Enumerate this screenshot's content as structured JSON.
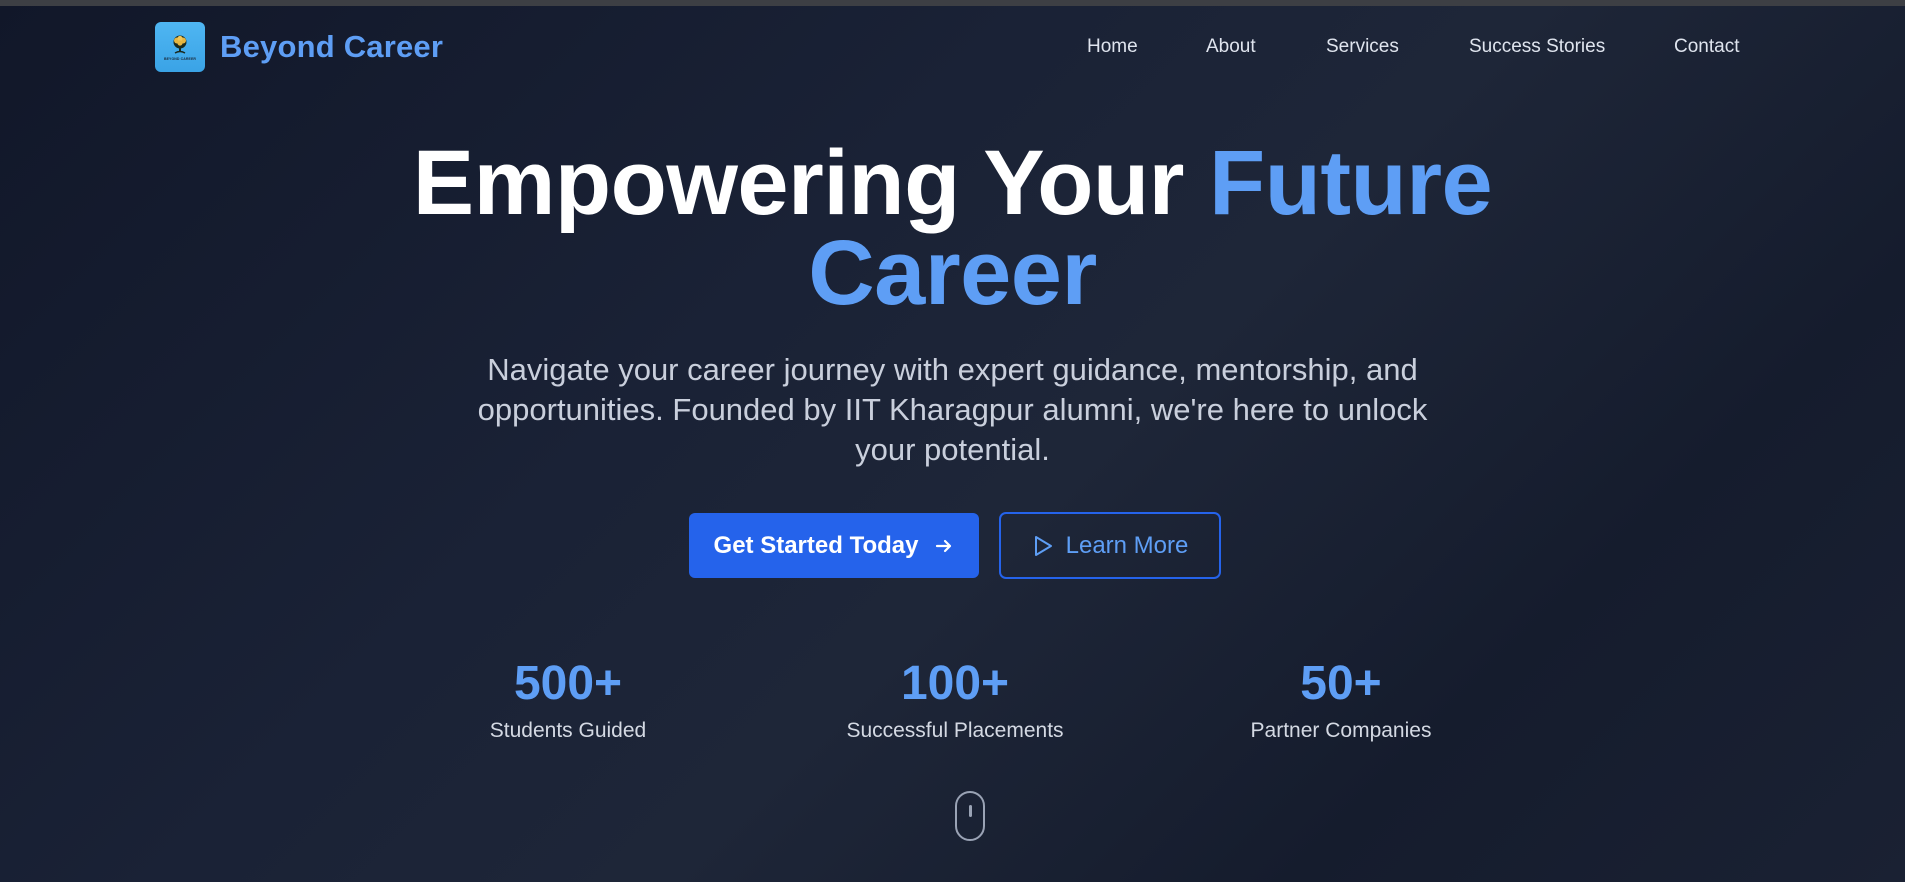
{
  "brand": {
    "name": "Beyond Career",
    "logo_text": "BEYOND CAREER"
  },
  "nav": {
    "items": [
      {
        "label": "Home"
      },
      {
        "label": "About"
      },
      {
        "label": "Services"
      },
      {
        "label": "Success Stories"
      },
      {
        "label": "Contact"
      }
    ]
  },
  "hero": {
    "title_part1": "Empowering Your ",
    "title_accent_line1": "Future",
    "title_accent_line2": "Career",
    "subtitle": "Navigate your career journey with expert guidance, mentorship, and opportunities. Founded by IIT Kharagpur alumni, we're here to unlock your potential.",
    "primary_button": "Get Started Today",
    "secondary_button": "Learn More"
  },
  "stats": [
    {
      "value": "500+",
      "label": "Students Guided"
    },
    {
      "value": "100+",
      "label": "Successful Placements"
    },
    {
      "value": "50+",
      "label": "Partner Companies"
    }
  ],
  "icons": {
    "logo": "tree-logo-icon",
    "primary_button_icon": "arrow-right-icon",
    "secondary_button_icon": "play-icon",
    "scroll_indicator": "mouse-scroll-icon"
  },
  "colors": {
    "accent": "#5e9ef5",
    "primary_button": "#2563eb",
    "background": "#1a2236"
  }
}
